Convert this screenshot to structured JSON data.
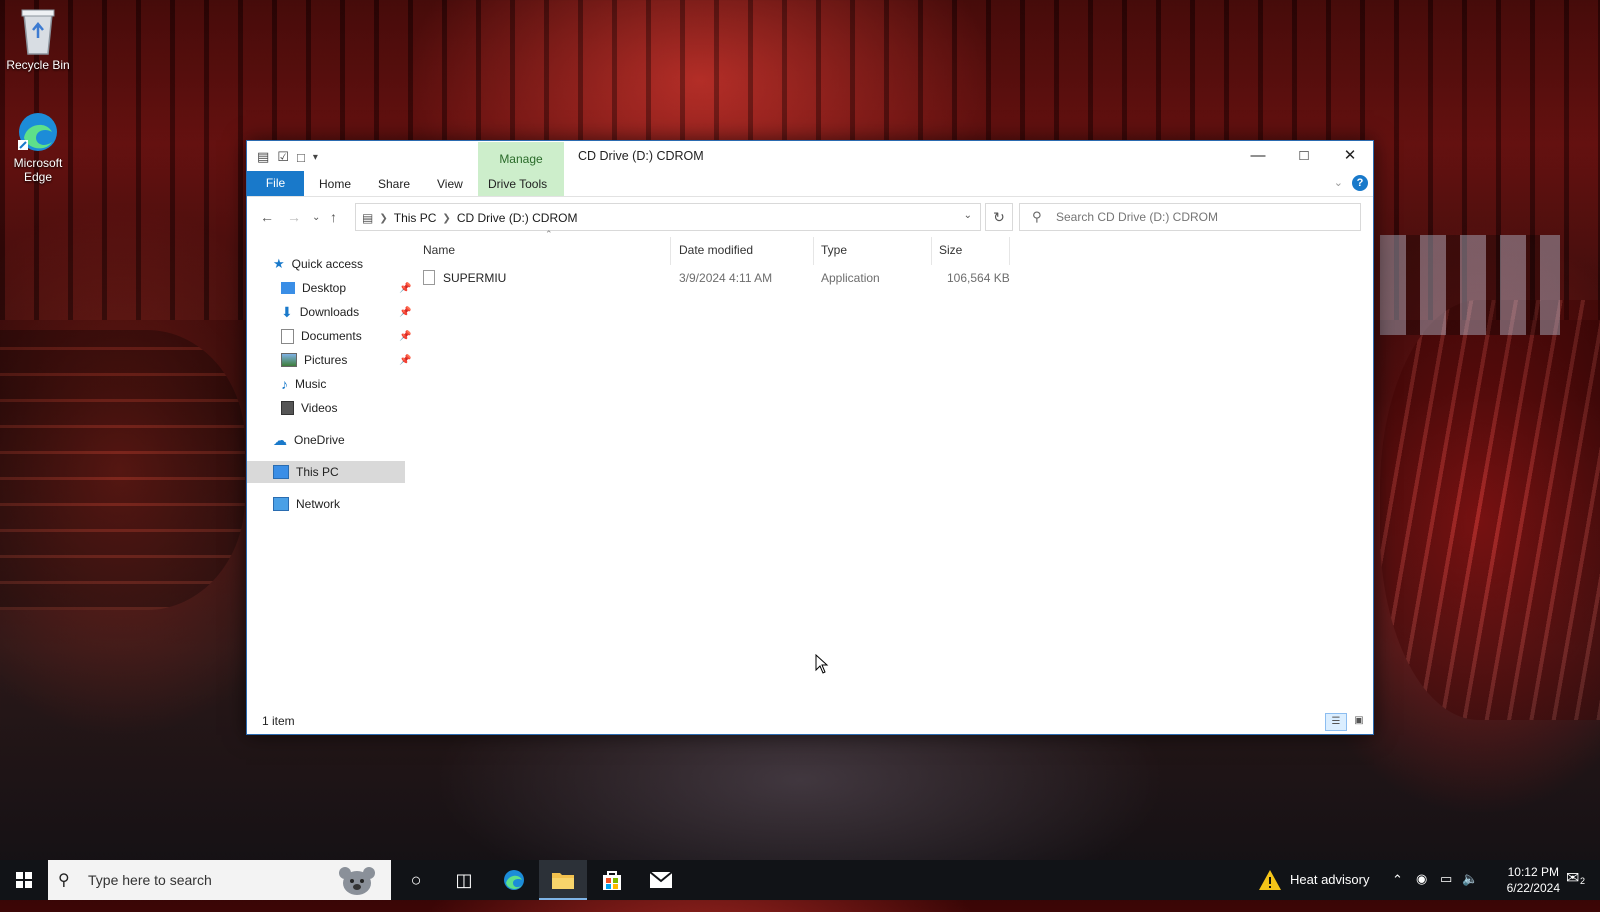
{
  "desktop": {
    "icons": [
      {
        "label": "Recycle Bin"
      },
      {
        "label": "Microsoft Edge"
      }
    ]
  },
  "window": {
    "title": "CD Drive (D:) CDROM",
    "manage_tab": "Manage",
    "ribbon_tabs": {
      "file": "File",
      "home": "Home",
      "share": "Share",
      "view": "View",
      "drive_tools": "Drive Tools"
    },
    "help_label": "?",
    "address": {
      "crumbs": [
        "This PC",
        "CD Drive (D:) CDROM"
      ]
    },
    "search": {
      "placeholder": "Search CD Drive (D:) CDROM"
    },
    "sidebar": {
      "quick_access": "Quick access",
      "items": [
        {
          "label": "Desktop",
          "pinned": true
        },
        {
          "label": "Downloads",
          "pinned": true
        },
        {
          "label": "Documents",
          "pinned": true
        },
        {
          "label": "Pictures",
          "pinned": true
        },
        {
          "label": "Music",
          "pinned": false
        },
        {
          "label": "Videos",
          "pinned": false
        }
      ],
      "onedrive": "OneDrive",
      "this_pc": "This PC",
      "network": "Network"
    },
    "columns": {
      "name": "Name",
      "date": "Date modified",
      "type": "Type",
      "size": "Size"
    },
    "files": [
      {
        "name": "SUPERMIU",
        "date": "3/9/2024 4:11 AM",
        "type": "Application",
        "size": "106,564 KB"
      }
    ],
    "status": {
      "count": "1 item"
    }
  },
  "taskbar": {
    "search_placeholder": "Type here to search",
    "weather": "Heat advisory",
    "time": "10:12 PM",
    "date": "6/22/2024",
    "notification_count": "2"
  },
  "colors": {
    "accent": "#1979ca",
    "manage_tab_bg": "#cdeecb",
    "taskbar_bg": "#111317",
    "selected_bg": "#d9d9d9"
  }
}
